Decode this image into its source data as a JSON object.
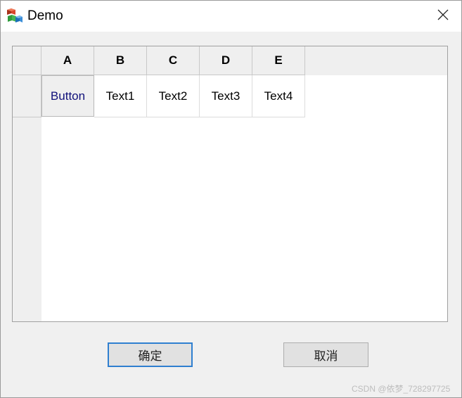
{
  "window": {
    "title": "Demo",
    "app_icon": "app-blocks-icon",
    "close_icon": "close-icon"
  },
  "grid": {
    "columns": [
      "A",
      "B",
      "C",
      "D",
      "E"
    ],
    "rows": [
      {
        "cells": [
          {
            "text": "Button",
            "kind": "button"
          },
          {
            "text": "Text1",
            "kind": "text"
          },
          {
            "text": "Text2",
            "kind": "text"
          },
          {
            "text": "Text3",
            "kind": "text"
          },
          {
            "text": "Text4",
            "kind": "text"
          }
        ]
      }
    ]
  },
  "buttons": {
    "ok_label": "确定",
    "cancel_label": "取消"
  },
  "watermark": "CSDN @依梦_728297725",
  "colors": {
    "focus_border": "#2f7fd0",
    "button_text": "#10107a"
  }
}
